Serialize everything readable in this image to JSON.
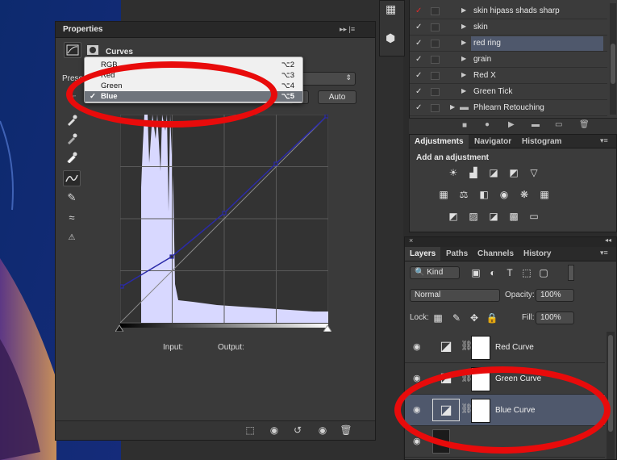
{
  "properties_panel": {
    "tab_title": "Properties",
    "title": "Curves",
    "header_controls": "▸▸ |≡",
    "preset_label": "Prese",
    "auto_button": "Auto",
    "input_label": "Input:",
    "output_label": "Output:",
    "tools": [
      "curve-adjust-icon",
      "eyedropper-black-icon",
      "eyedropper-gray-icon",
      "eyedropper-white-icon",
      "curve-points-icon",
      "pencil-icon",
      "smooth-icon",
      "clipping-warning-icon"
    ]
  },
  "channel_dropdown": {
    "items": [
      {
        "label": "RGB",
        "shortcut": "⌥2",
        "selected": false
      },
      {
        "label": "Red",
        "shortcut": "⌥3",
        "selected": false
      },
      {
        "label": "Green",
        "shortcut": "⌥4",
        "selected": false
      },
      {
        "label": "Blue",
        "shortcut": "⌥5",
        "selected": true
      }
    ],
    "check": "✓"
  },
  "layer_comps": {
    "rows": [
      {
        "name": "skin hipass shads sharp",
        "tick": "✓",
        "tick_color": "#e02a2a",
        "highlight": false
      },
      {
        "name": "skin",
        "tick": "✓",
        "tick_color": "#e0e0e0",
        "highlight": false
      },
      {
        "name": "red ring",
        "tick": "✓",
        "tick_color": "#e0e0e0",
        "highlight": true
      },
      {
        "name": "grain",
        "tick": "✓",
        "tick_color": "#e0e0e0",
        "highlight": false
      },
      {
        "name": "Red X",
        "tick": "✓",
        "tick_color": "#e0e0e0",
        "highlight": false
      },
      {
        "name": "Green Tick",
        "tick": "✓",
        "tick_color": "#e0e0e0",
        "highlight": false
      },
      {
        "name": "Phlearn Retouching",
        "tick": "✓",
        "tick_color": "#e0e0e0",
        "highlight": false,
        "folder": true
      }
    ]
  },
  "adjustments_panel": {
    "tabs": [
      "Adjustments",
      "Navigator",
      "Histogram"
    ],
    "title": "Add an adjustment"
  },
  "layers_panel": {
    "tabs": [
      "Layers",
      "Paths",
      "Channels",
      "History"
    ],
    "kind_label": "Kind",
    "blend_mode": "Normal",
    "opacity_label": "Opacity:",
    "opacity_value": "100%",
    "lock_label": "Lock:",
    "fill_label": "Fill:",
    "fill_value": "100%",
    "layers": [
      {
        "name": "Red Curve",
        "selected": false
      },
      {
        "name": "Green Curve",
        "selected": false
      },
      {
        "name": "Blue Curve",
        "selected": true
      }
    ]
  },
  "colors": {
    "annotation_red": "#e80b0b",
    "curve_blue": "#2a2aa8",
    "histogram_fill": "#d8d8ff",
    "selection": "#4f586c"
  }
}
